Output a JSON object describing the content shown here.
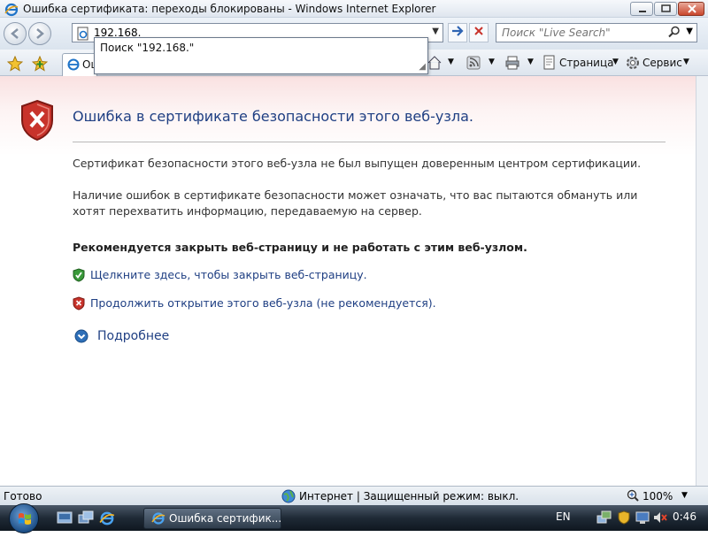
{
  "window": {
    "title": "Ошибка сертификата: переходы блокированы - Windows Internet Explorer"
  },
  "address": {
    "value": "192.168.",
    "suggestion": "Поиск \"192.168.\""
  },
  "search": {
    "placeholder": "Поиск \"Live Search\""
  },
  "tab": {
    "label": "Ошибка сертификата: переходы блокированы"
  },
  "commandbar": {
    "page_label": "Страница",
    "tools_label": "Сервис"
  },
  "content": {
    "title": "Ошибка в сертификате безопасности этого веб-узла.",
    "para1": "Сертификат безопасности этого веб-узла не был выпущен доверенным центром сертификации.",
    "para2": "Наличие ошибок в сертификате безопасности может означать, что вас пытаются обмануть или хотят перехватить информацию, передаваемую на сервер.",
    "recommend": "Рекомендуется закрыть веб-страницу и не работать с этим веб-узлом.",
    "close_link": "Щелкните здесь, чтобы закрыть веб-страницу.",
    "continue_link": "Продолжить открытие этого веб-узла (не рекомендуется).",
    "more_info": "Подробнее"
  },
  "statusbar": {
    "status": "Готово",
    "zone": "Интернет | Защищенный режим: выкл.",
    "zoom": "100%"
  },
  "taskbar": {
    "window_button": "Ошибка сертифик...",
    "language": "EN",
    "clock": "0:46"
  },
  "colors": {
    "link": "#1f3f83",
    "error_red": "#c8332b",
    "safe_green": "#3a9a3a"
  }
}
